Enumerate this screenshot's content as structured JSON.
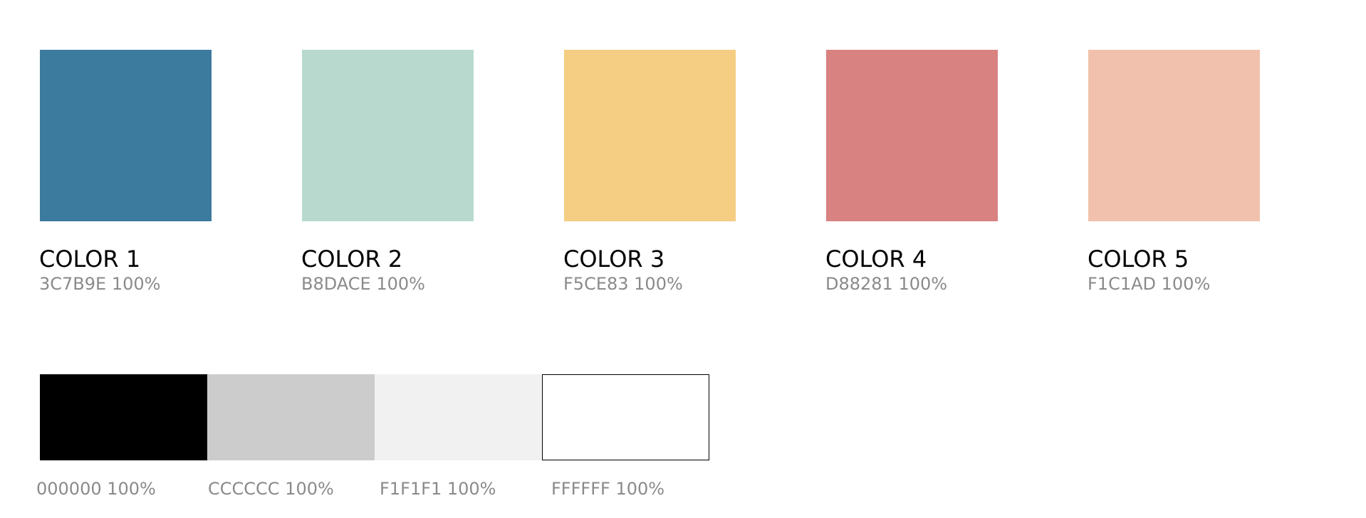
{
  "primary_colors": [
    {
      "name": "COLOR 1",
      "code": "3C7B9E 100%",
      "hex": "#3C7B9E"
    },
    {
      "name": "COLOR 2",
      "code": "B8DACE 100%",
      "hex": "#B8DACE"
    },
    {
      "name": "COLOR 3",
      "code": "F5CE83 100%",
      "hex": "#F5CE83"
    },
    {
      "name": "COLOR 4",
      "code": "D88281 100%",
      "hex": "#D88281"
    },
    {
      "name": "COLOR 5",
      "code": "F1C1AD 100%",
      "hex": "#F1C1AD"
    }
  ],
  "neutral_colors": [
    {
      "code": "000000 100%",
      "hex": "#000000"
    },
    {
      "code": "CCCCCC 100%",
      "hex": "#CCCCCC"
    },
    {
      "code": "F1F1F1 100%",
      "hex": "#F1F1F1"
    },
    {
      "code": "FFFFFF 100%",
      "hex": "#FFFFFF"
    }
  ],
  "colors": {
    "label_text": "#000000",
    "code_text": "#8A8A8A",
    "white_swatch_border": "#000000"
  }
}
